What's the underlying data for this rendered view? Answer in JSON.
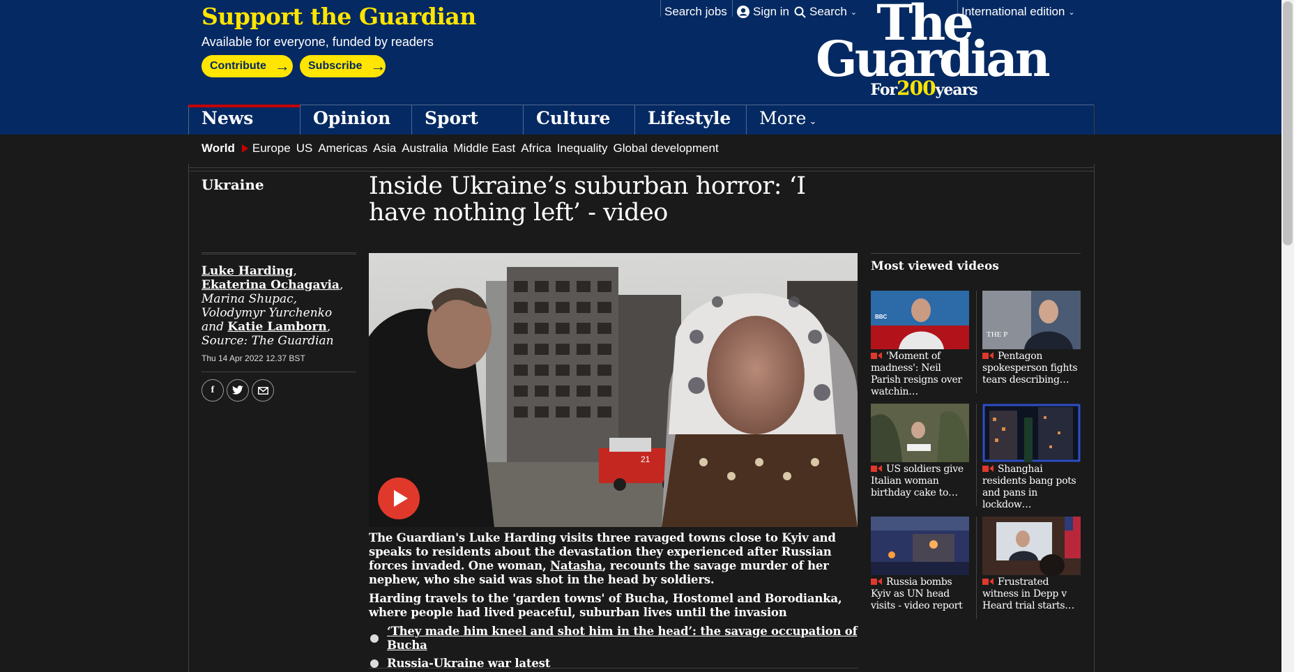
{
  "support": {
    "title": "Support the Guardian",
    "subtitle": "Available for everyone, funded by readers",
    "contribute": "Contribute",
    "subscribe": "Subscribe"
  },
  "top_links": {
    "search_jobs": "Search jobs",
    "sign_in": "Sign in",
    "search": "Search",
    "edition": "International edition"
  },
  "logo": {
    "line1": "The",
    "line2": "Guardian",
    "for": "For",
    "year": "200",
    "years": "years"
  },
  "pillars": [
    "News",
    "Opinion",
    "Sport",
    "Culture",
    "Lifestyle",
    "More"
  ],
  "subnav": [
    "World",
    "Europe",
    "US",
    "Americas",
    "Asia",
    "Australia",
    "Middle East",
    "Africa",
    "Inequality",
    "Global development"
  ],
  "article": {
    "section": "Ukraine",
    "headline": "Inside Ukraine’s suburban horror: ‘I have nothing left’ - video",
    "byline": {
      "n1": "Luke Harding",
      "sep1": ", ",
      "n2": "Ekaterina Ochagavia",
      "mid": ", Marina Shupac, Volodymyr Yurchenko and ",
      "n3": "Katie Lamborn",
      "end": ", Source: The Guardian"
    },
    "date": "Thu 14 Apr 2022 12.37 BST",
    "standfirst": {
      "p1_a": "The Guardian's Luke Harding visits three ravaged towns close to Kyiv and speaks to residents about the devastation they experienced after Russian forces invaded. One woman, ",
      "p1_link": "Natasha",
      "p1_b": ", recounts the savage murder of her nephew, who she said was shot in the head by soldiers.",
      "p2": "Harding travels to the 'garden towns' of Bucha, Hostomel and Borodianka, where people had lived peaceful, suburban lives until the invasion"
    },
    "related": [
      "‘They made him kneel and shot him in the head’: the savage occupation of Bucha",
      "Russia-Ukraine war latest"
    ],
    "video_text": {
      "building_number": "21"
    }
  },
  "most_viewed": {
    "title": "Most viewed videos",
    "items": [
      {
        "text": "'Moment of madness': Neil Parish resigns over watchin…",
        "thumb_text": "BBC"
      },
      {
        "text": "Pentagon spokesperson fights tears describing…",
        "thumb_text": "THE P"
      },
      {
        "text": "US soldiers give Italian woman birthday cake to…",
        "thumb_text": ""
      },
      {
        "text": "Shanghai residents bang pots and pans in lockdow…",
        "thumb_text": ""
      },
      {
        "text": "Russia bombs Kyiv as UN head visits - video report",
        "thumb_text": ""
      },
      {
        "text": "Frustrated witness in Depp v Heard trial starts…",
        "thumb_text": ""
      }
    ]
  },
  "colors": {
    "brand_blue": "#052962",
    "yellow": "#ffe500",
    "news_red": "#c70000",
    "video_red": "#e0392c",
    "background": "#1a1a1a"
  }
}
